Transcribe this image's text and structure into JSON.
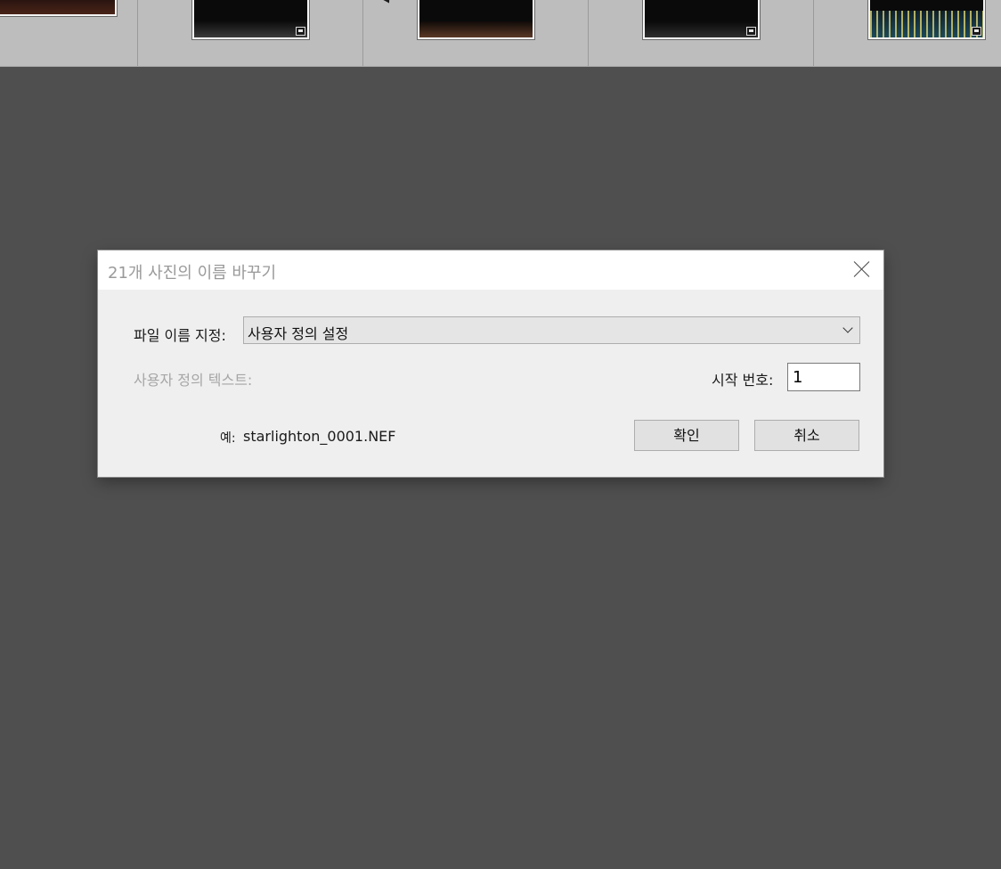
{
  "filmstrip": {
    "thumbnails": [
      {
        "tint": "#3a1d16"
      },
      {
        "tint": "#2c2c2c"
      },
      {
        "tint": "#3f2a20"
      },
      {
        "tint": "#232323"
      },
      {
        "tint": "#1a3a46"
      }
    ]
  },
  "dialog": {
    "title": "21개 사진의 이름 바꾸기",
    "file_naming_label": "파일 이름 지정:",
    "file_naming_value": "사용자 정의 설정",
    "custom_text_label": "사용자 정의 텍스트:",
    "start_number_label": "시작 번호:",
    "start_number_value": "1",
    "example_label": "예:",
    "example_value": "starlighton_0001.NEF",
    "ok_label": "확인",
    "cancel_label": "취소"
  }
}
